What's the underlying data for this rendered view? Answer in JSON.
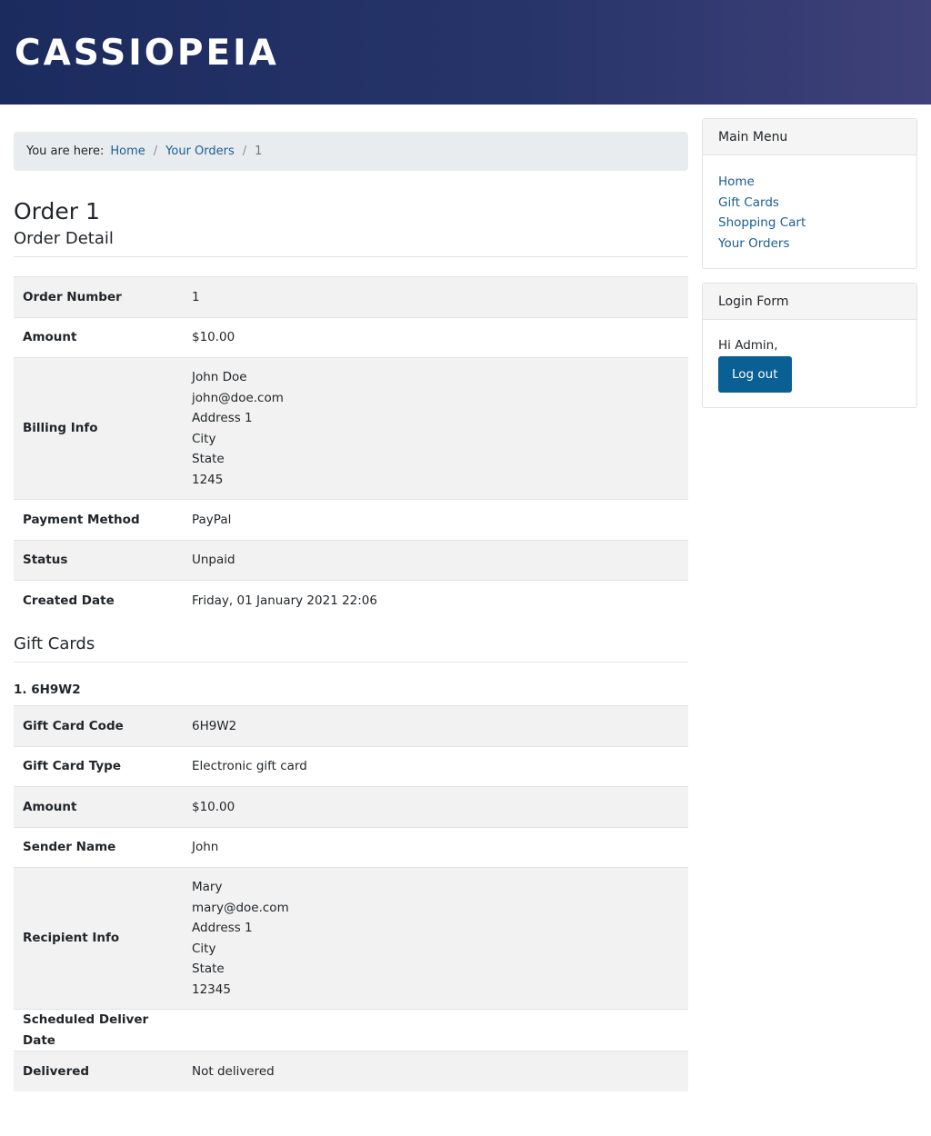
{
  "site": {
    "brand": "CASSIOPEIA"
  },
  "breadcrumb": {
    "prefix": "You are here:",
    "items": [
      "Home",
      "Your Orders"
    ],
    "current": "1",
    "separator": "/"
  },
  "page": {
    "title": "Order 1",
    "order_detail_heading": "Order Detail",
    "gift_cards_heading": "Gift Cards"
  },
  "order": {
    "number_label": "Order Number",
    "number": "1",
    "amount_label": "Amount",
    "amount": "$10.00",
    "billing_label": "Billing Info",
    "billing": {
      "name": "John Doe",
      "email": "john@doe.com",
      "address": "Address 1",
      "city": "City",
      "state": "State",
      "zip": "1245"
    },
    "payment_label": "Payment Method",
    "payment": "PayPal",
    "status_label": "Status",
    "status": "Unpaid",
    "created_label": "Created Date",
    "created": "Friday, 01 January 2021 22:06"
  },
  "gift_card": {
    "item_title": "1. 6H9W2",
    "code_label": "Gift Card Code",
    "code": "6H9W2",
    "type_label": "Gift Card Type",
    "type": "Electronic gift card",
    "amount_label": "Amount",
    "amount": "$10.00",
    "sender_label": "Sender Name",
    "sender": "John",
    "recipient_label": "Recipient Info",
    "recipient": {
      "name": "Mary",
      "email": "mary@doe.com",
      "address": "Address 1",
      "city": "City",
      "state": "State",
      "zip": "12345"
    },
    "schedule_label": "Scheduled Deliver Date",
    "schedule": "",
    "delivered_label": "Delivered",
    "delivered": "Not delivered"
  },
  "sidebar": {
    "main_menu": {
      "title": "Main Menu",
      "items": [
        "Home",
        "Gift Cards",
        "Shopping Cart",
        "Your Orders"
      ]
    },
    "login": {
      "title": "Login Form",
      "greeting": "Hi Admin,",
      "logout_label": "Log out"
    }
  },
  "colors": {
    "link": "#1a5e93",
    "button": "#0a5f94",
    "header_start": "#1c2b5e",
    "header_end": "#3f4178"
  }
}
